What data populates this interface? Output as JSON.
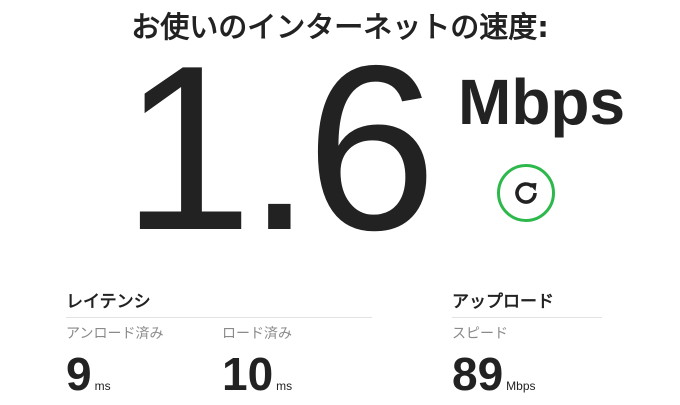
{
  "title": "お使いのインターネットの速度:",
  "speed": {
    "value": "1.6",
    "unit": "Mbps"
  },
  "refresh": {
    "icon": "refresh-icon",
    "color": "#2db84b"
  },
  "latency": {
    "heading": "レイテンシ",
    "unloaded": {
      "label": "アンロード済み",
      "value": "9",
      "unit": "ms"
    },
    "loaded": {
      "label": "ロード済み",
      "value": "10",
      "unit": "ms"
    }
  },
  "upload": {
    "heading": "アップロード",
    "speed": {
      "label": "スピード",
      "value": "89",
      "unit": "Mbps"
    }
  }
}
